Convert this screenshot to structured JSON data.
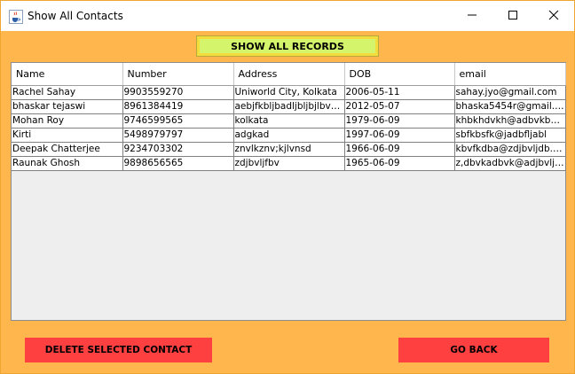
{
  "window": {
    "title": "Show All Contacts",
    "icon": "java-cup-icon"
  },
  "toolbar": {
    "show_all_label": "SHOW ALL RECORDS"
  },
  "table": {
    "columns": [
      "Name",
      "Number",
      "Address",
      "DOB",
      "email"
    ],
    "rows": [
      [
        "Rachel Sahay",
        "9903559270",
        "Uniworld City, Kolkata",
        "2006-05-11",
        "sahay.jyo@gmail.com"
      ],
      [
        "bhaskar tejaswi",
        "8961384419",
        "aebjfkbljbadljbljbjlbv@...",
        "2012-05-07",
        "bhaska5454r@gmail.com"
      ],
      [
        "Mohan Roy",
        "9746599565",
        "kolkata",
        "1979-06-09",
        "khbkhdvkh@adbvkbdjvbj"
      ],
      [
        "Kirti",
        "5498979797",
        "adgkad",
        "1997-06-09",
        "sbfkbsfk@jadbfljabl"
      ],
      [
        "Deepak Chatterjee",
        "9234703302",
        "znvlkznv;kjlvnsd",
        "1966-06-09",
        "kbvfkdba@zdjbvljdb.com"
      ],
      [
        "Raunak Ghosh",
        "9898656565",
        "zdjbvljfbv",
        "1965-06-09",
        "z,dbvkadbvk@adjbvlja..."
      ]
    ]
  },
  "actions": {
    "delete_label": "DELETE SELECTED CONTACT",
    "back_label": "GO BACK"
  },
  "colors": {
    "background": "#ffb74d",
    "show_button": "#d4f56b",
    "action_buttons": "#ff4040"
  }
}
